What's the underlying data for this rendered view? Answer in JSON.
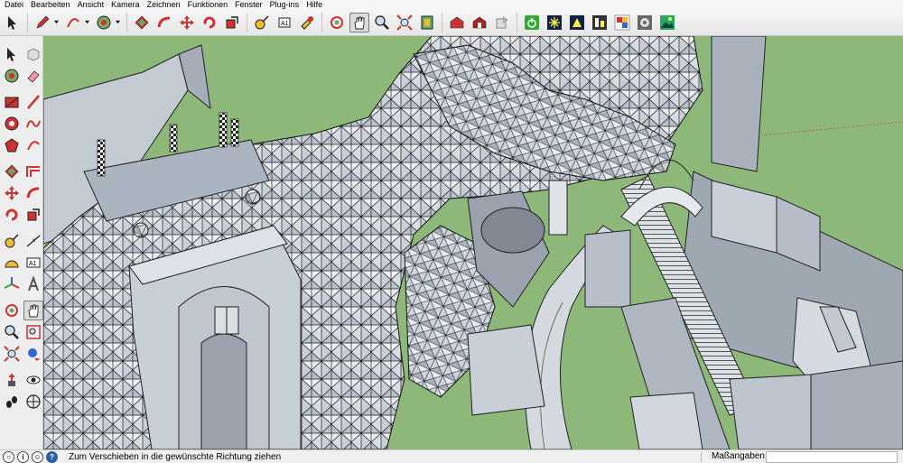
{
  "menu": [
    "Datei",
    "Bearbeiten",
    "Ansicht",
    "Kamera",
    "Zeichnen",
    "Funktionen",
    "Fenster",
    "Plug-ins",
    "Hilfe"
  ],
  "toolbar": {
    "icons": [
      "select-arrow-icon",
      "pencil-icon",
      "arc-icon",
      "paint-bucket-icon",
      "push-pull-icon",
      "follow-me-icon",
      "move-icon",
      "rotate-icon",
      "scale-icon",
      "tape-measure-icon",
      "text-label-icon",
      "paint-icon",
      "orbit-icon",
      "pan-hand-icon",
      "zoom-icon",
      "zoom-extents-icon",
      "components-icon",
      "warehouse-get-icon",
      "warehouse-share-icon",
      "export-icon",
      "power-icon",
      "sun-sparkle-icon",
      "shadow-icon",
      "fog-icon",
      "style-icon",
      "settings-gear-icon",
      "photo-landscape-icon"
    ]
  },
  "left_toolbar": {
    "pairs": [
      [
        "select-arrow-icon",
        "component-icon"
      ],
      [
        "paint-bucket-icon",
        "eraser-icon"
      ],
      [
        "rectangle-icon",
        "line-icon"
      ],
      [
        "circle-icon",
        "freehand-icon"
      ],
      [
        "polygon-icon",
        "arc-icon"
      ],
      [
        "push-pull-icon",
        "offset-icon"
      ],
      [
        "move-icon",
        "follow-me-icon"
      ],
      [
        "rotate-icon",
        "scale-icon"
      ],
      [
        "tape-measure-icon",
        "dimension-icon"
      ],
      [
        "protractor-icon",
        "text-icon"
      ],
      [
        "axes-icon",
        "3d-text-icon"
      ],
      [
        "orbit-icon",
        "pan-hand-icon"
      ],
      [
        "zoom-icon",
        "zoom-window-icon"
      ],
      [
        "zoom-extents-icon",
        "previous-view-icon"
      ],
      [
        "position-camera-icon",
        "look-around-icon"
      ],
      [
        "walk-icon",
        "section-plane-icon"
      ]
    ]
  },
  "status": {
    "text": "Zum Verschieben in die gewünschte Richtung ziehen",
    "measure_label": "Maßangaben",
    "measure_value": ""
  },
  "colors": {
    "ground": "#8db87a",
    "facade": "#c9cfd6",
    "roof": "#aab4c0",
    "shadow": "#9aa3ad",
    "mesh_stroke": "#1a1a1a"
  }
}
